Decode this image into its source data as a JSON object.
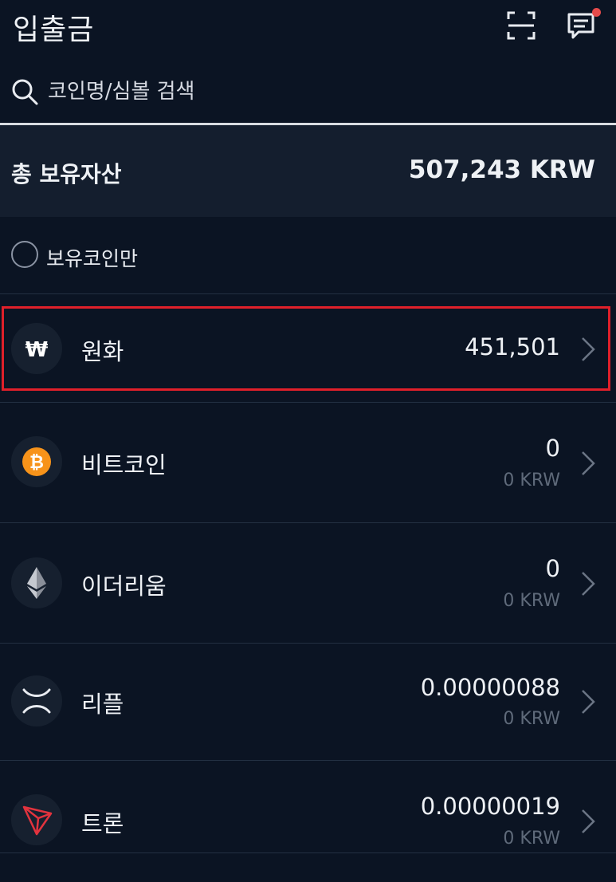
{
  "header": {
    "title": "입출금",
    "scan_icon": "scan-icon",
    "chat_icon": "chat-icon",
    "has_notification": true
  },
  "search": {
    "placeholder": "코인명/심볼 검색"
  },
  "total": {
    "label": "총 보유자산",
    "value": "507,243 KRW"
  },
  "filter": {
    "label": "보유코인만",
    "checked": false
  },
  "coins": [
    {
      "name": "원화",
      "icon": "won-icon",
      "amount": "451,501",
      "krw": ""
    },
    {
      "name": "비트코인",
      "icon": "bitcoin-icon",
      "amount": "0",
      "krw": "0 KRW"
    },
    {
      "name": "이더리움",
      "icon": "ethereum-icon",
      "amount": "0",
      "krw": "0 KRW"
    },
    {
      "name": "리플",
      "icon": "ripple-icon",
      "amount": "0.00000088",
      "krw": "0 KRW"
    },
    {
      "name": "트론",
      "icon": "tron-icon",
      "amount": "0.00000019",
      "krw": "0 KRW"
    }
  ],
  "colors": {
    "background": "#0b1423",
    "highlight_border": "#e0202a",
    "bitcoin": "#f7931a",
    "tron": "#e2333e",
    "notification_dot": "#e54b4b"
  }
}
